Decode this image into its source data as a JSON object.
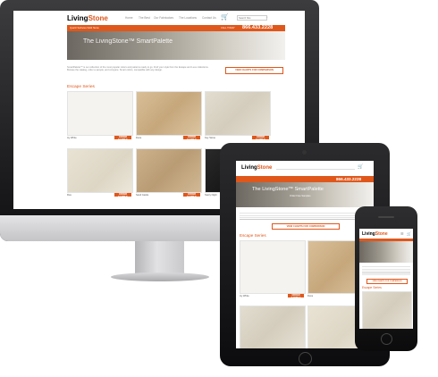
{
  "logo": {
    "part1": "Living",
    "part2": "Stone"
  },
  "desktop": {
    "nav": [
      "Home",
      "The Best",
      "Our Fabricators",
      "The Locations",
      "Contact Us"
    ],
    "search_placeholder": "Search Site",
    "orange_bar_left": "Quartz Surfaces  Solid Stone",
    "phone_label": "CALL TODAY",
    "phone": "866.433.2228",
    "hero_title": "The LivingStone™ SmartPalette",
    "intro_text": "SmartPalette™ is our collection of the most popular colors and patterns ready to go. Find your style from the Escape and Luxe collections. Browse the catalog, order a sample, and compare. Smart colors, compatible with any design.",
    "compare_button": "VIEW CHARTS FOR COMPARISON",
    "series_title": "Escape Series",
    "swatches": [
      {
        "name": "Icy White",
        "button": "ORDER SAMPLE"
      },
      {
        "name": "Dune",
        "button": "ORDER SAMPLE"
      },
      {
        "name": "Key Stone",
        "button": "ORDER SAMPLE"
      },
      {
        "name": "Flax",
        "button": "ORDER SAMPLE"
      },
      {
        "name": "Sand Castle",
        "button": "ORDER SAMPLE"
      },
      {
        "name": "Starry Night",
        "button": "ORDER SAMPLE"
      }
    ]
  },
  "tablet": {
    "phone": "866.433.2228",
    "hero_title": "The LivingStone™ SmartPalette",
    "hero_sub": "Order Free Samples",
    "compare_button": "VIEW CHARTS FOR COMPARISON",
    "series_title": "Escape Series",
    "swatches": [
      {
        "name": "Icy White",
        "button": "ORDER SAMPLE"
      },
      {
        "name": "Dune",
        "button": "ORDER SAMPLE"
      }
    ]
  },
  "phone": {
    "compare_button": "VIEW CHARTS FOR COMPARISON",
    "series_title": "Escape Series"
  },
  "colors": {
    "accent": "#e0571b",
    "bezel": "#1a1a1c",
    "stand": "#c8c8ca"
  }
}
